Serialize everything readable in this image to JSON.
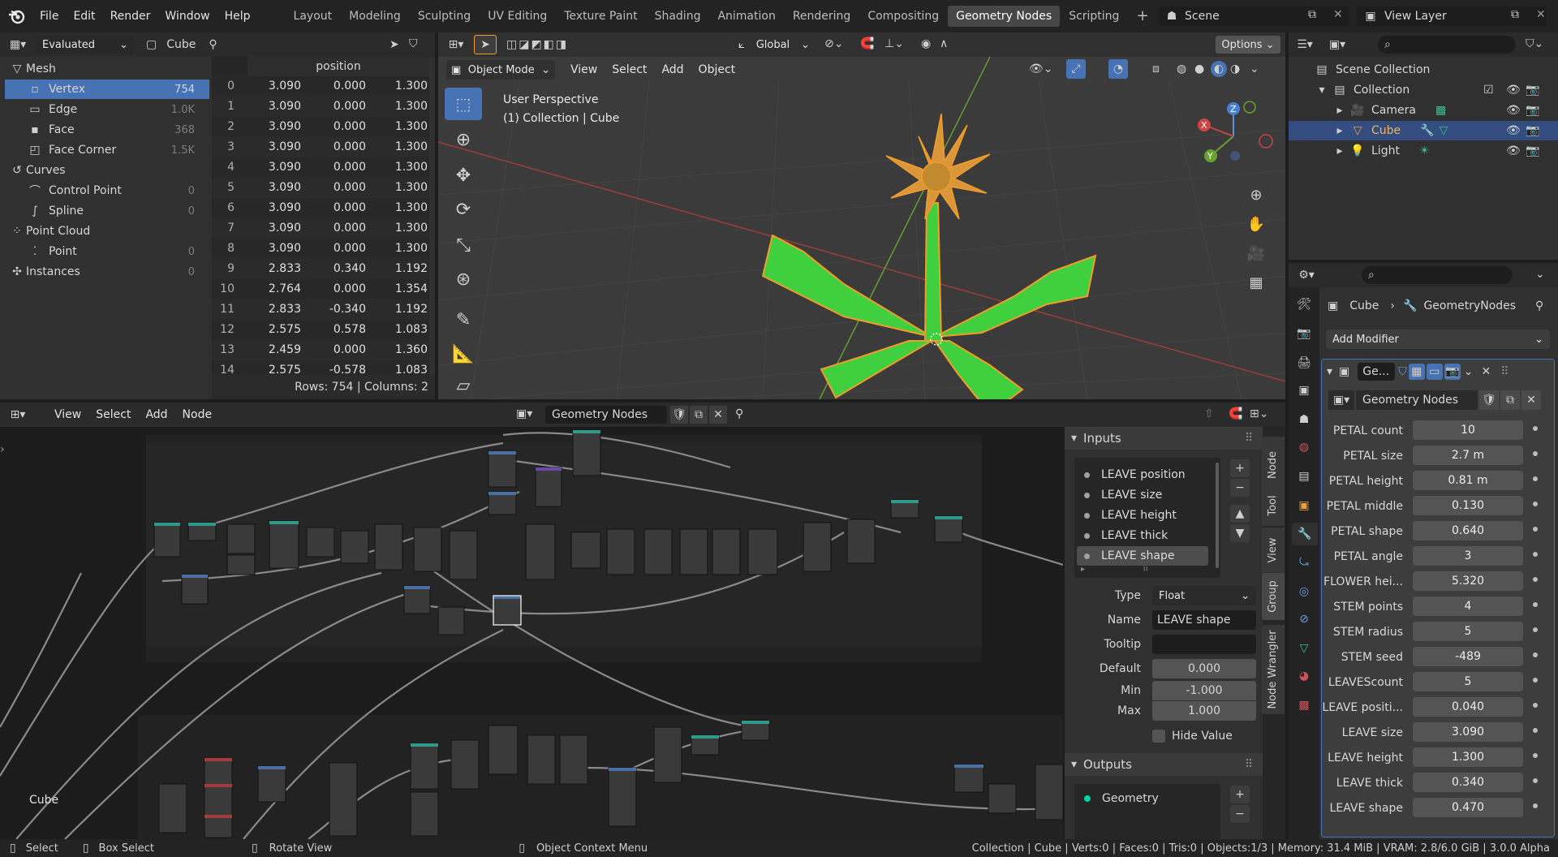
{
  "topbar": {
    "menus": [
      "File",
      "Edit",
      "Render",
      "Window",
      "Help"
    ],
    "workspaces": [
      "Layout",
      "Modeling",
      "Sculpting",
      "UV Editing",
      "Texture Paint",
      "Shading",
      "Animation",
      "Rendering",
      "Compositing",
      "Geometry Nodes",
      "Scripting"
    ],
    "active_workspace": "Geometry Nodes",
    "add_tab": "+",
    "scene": "Scene",
    "view_layer": "View Layer"
  },
  "spreadsheet": {
    "mode": "Evaluated",
    "object": "Cube",
    "column_header": "position",
    "tree": [
      {
        "label": "Mesh",
        "count": "",
        "level": 0
      },
      {
        "label": "Vertex",
        "count": "754",
        "level": 1,
        "selected": true
      },
      {
        "label": "Edge",
        "count": "1.0K",
        "level": 1
      },
      {
        "label": "Face",
        "count": "368",
        "level": 1
      },
      {
        "label": "Face Corner",
        "count": "1.5K",
        "level": 1
      },
      {
        "label": "Curves",
        "count": "",
        "level": 0
      },
      {
        "label": "Control Point",
        "count": "0",
        "level": 1
      },
      {
        "label": "Spline",
        "count": "0",
        "level": 1
      },
      {
        "label": "Point Cloud",
        "count": "",
        "level": 0
      },
      {
        "label": "Point",
        "count": "0",
        "level": 1
      },
      {
        "label": "Instances",
        "count": "0",
        "level": 0
      }
    ],
    "rows": [
      [
        "0",
        "3.090",
        "0.000",
        "1.300"
      ],
      [
        "1",
        "3.090",
        "0.000",
        "1.300"
      ],
      [
        "2",
        "3.090",
        "0.000",
        "1.300"
      ],
      [
        "3",
        "3.090",
        "0.000",
        "1.300"
      ],
      [
        "4",
        "3.090",
        "0.000",
        "1.300"
      ],
      [
        "5",
        "3.090",
        "0.000",
        "1.300"
      ],
      [
        "6",
        "3.090",
        "0.000",
        "1.300"
      ],
      [
        "7",
        "3.090",
        "0.000",
        "1.300"
      ],
      [
        "8",
        "3.090",
        "0.000",
        "1.300"
      ],
      [
        "9",
        "2.833",
        "0.340",
        "1.192"
      ],
      [
        "10",
        "2.764",
        "0.000",
        "1.354"
      ],
      [
        "11",
        "2.833",
        "-0.340",
        "1.192"
      ],
      [
        "12",
        "2.575",
        "0.578",
        "1.083"
      ],
      [
        "13",
        "2.459",
        "0.000",
        "1.360"
      ],
      [
        "14",
        "2.575",
        "-0.578",
        "1.083"
      ]
    ],
    "footer": "Rows: 754   |   Columns: 2"
  },
  "viewport": {
    "orientation": "Global",
    "options": "Options",
    "mode": "Object Mode",
    "menus": [
      "View",
      "Select",
      "Add",
      "Object"
    ],
    "overlay_line1": "User Perspective",
    "overlay_line2": "(1) Collection | Cube",
    "gizmo": {
      "x": "X",
      "y": "Y",
      "z": "Z"
    }
  },
  "outliner": {
    "root": "Scene Collection",
    "collection": "Collection",
    "items": [
      {
        "label": "Camera",
        "selected": false
      },
      {
        "label": "Cube",
        "selected": true
      },
      {
        "label": "Light",
        "selected": false
      }
    ]
  },
  "properties": {
    "object": "Cube",
    "nodegroup_name": "GeometryNodes",
    "add_modifier": "Add Modifier",
    "modifier_short": "Ge...",
    "node_tree": "Geometry Nodes",
    "inputs": [
      {
        "label": "PETAL count",
        "value": "10"
      },
      {
        "label": "PETAL size",
        "value": "2.7 m"
      },
      {
        "label": "PETAL height",
        "value": "0.81 m"
      },
      {
        "label": "PETAL middle",
        "value": "0.130"
      },
      {
        "label": "PETAL shape",
        "value": "0.640"
      },
      {
        "label": "PETAL angle",
        "value": "3"
      },
      {
        "label": "FLOWER hei...",
        "value": "5.320"
      },
      {
        "label": "STEM points",
        "value": "4"
      },
      {
        "label": "STEM radius",
        "value": "5"
      },
      {
        "label": "STEM seed",
        "value": "-489"
      },
      {
        "label": "LEAVEScount",
        "value": "5"
      },
      {
        "label": "LEAVE positi...",
        "value": "0.040"
      },
      {
        "label": "LEAVE size",
        "value": "3.090"
      },
      {
        "label": "LEAVE height",
        "value": "1.300"
      },
      {
        "label": "LEAVE thick",
        "value": "0.340"
      },
      {
        "label": "LEAVE shape",
        "value": "0.470"
      }
    ]
  },
  "node_editor": {
    "menus": [
      "View",
      "Select",
      "Add",
      "Node"
    ],
    "tree_name": "Geometry Nodes",
    "frame_label": "Cube",
    "sidebar": {
      "inputs_title": "Inputs",
      "inputs": [
        "LEAVE position",
        "LEAVE size",
        "LEAVE height",
        "LEAVE thick",
        "LEAVE shape"
      ],
      "selected_input": "LEAVE shape",
      "type_label": "Type",
      "type_value": "Float",
      "name_label": "Name",
      "name_value": "LEAVE shape",
      "tooltip_label": "Tooltip",
      "tooltip_value": "",
      "default_label": "Default",
      "default_value": "0.000",
      "min_label": "Min",
      "min_value": "-1.000",
      "max_label": "Max",
      "max_value": "1.000",
      "hide_value": "Hide Value",
      "outputs_title": "Outputs",
      "outputs": [
        "Geometry"
      ]
    },
    "tabs": [
      "Node",
      "Tool",
      "View",
      "Group",
      "Node Wrangler"
    ]
  },
  "statusbar": {
    "select": "Select",
    "box_select": "Box Select",
    "rotate_view": "Rotate View",
    "context_menu": "Object Context Menu",
    "stats": "Collection | Cube | Verts:0 | Faces:0 | Tris:0 | Objects:1/3 | Memory: 31.4 MiB | VRAM: 2.8/6.0 GiB | 3.0.0 Alpha"
  },
  "colors": {
    "accent": "#4772b3",
    "leaf_green": "#3fcf3f",
    "petal_orange": "#e8a13c",
    "selection_outline": "#f29d2a"
  }
}
